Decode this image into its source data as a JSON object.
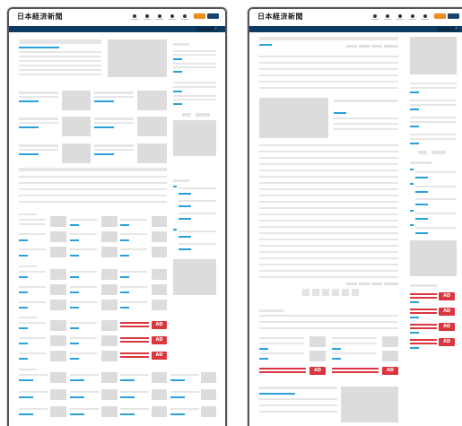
{
  "left_page": {
    "logo": "日本経済新聞",
    "logo_sub": "· · · · · ·",
    "ad_label": "AD",
    "search_icon": "search-icon"
  },
  "right_page": {
    "logo": "日本経済新聞",
    "logo_sub": "· · · · · ·",
    "ad_label": "AD",
    "search_icon": "search-icon"
  },
  "colors": {
    "navbar": "#0e3b63",
    "accent_orange": "#ec8d1b",
    "accent_navy": "#17456f",
    "link_blue": "#2aa0da",
    "ad_red": "#d9363e",
    "placeholder_gray": "#dcdcdc"
  }
}
